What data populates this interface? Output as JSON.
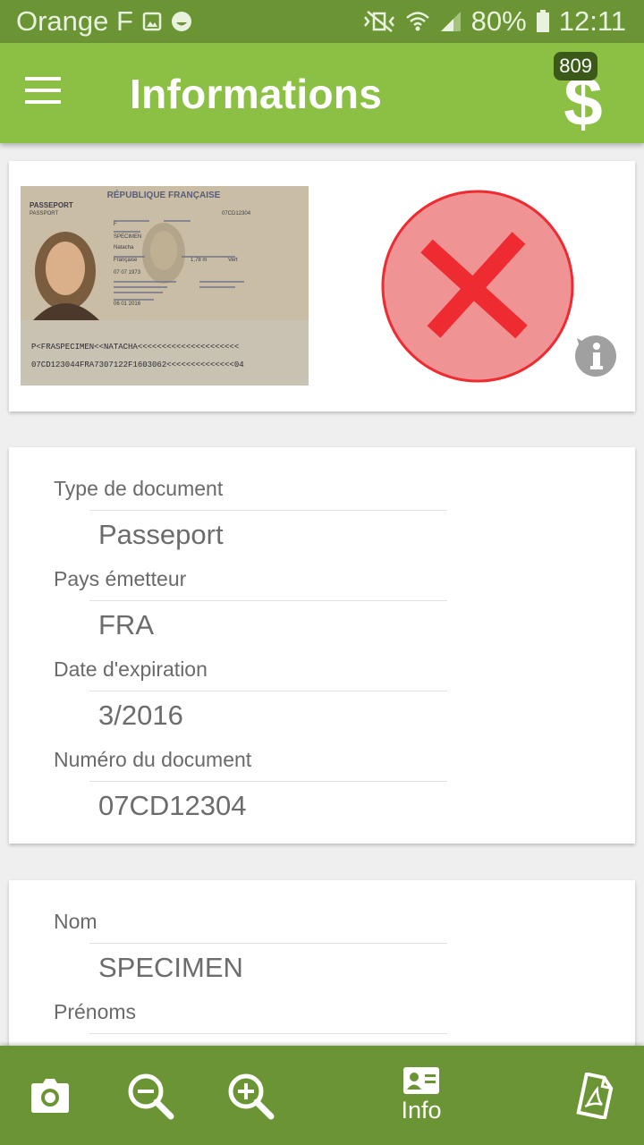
{
  "status_bar": {
    "carrier": "Orange F",
    "battery": "80%",
    "time": "12:11",
    "icons": [
      "image-icon",
      "smiley-icon",
      "vibrate-off-icon",
      "wifi-icon",
      "signal-icon",
      "battery-icon"
    ]
  },
  "app_bar": {
    "title": "Informations",
    "credits": "809",
    "menu_icon": "hamburger-menu-icon",
    "credits_icon": "dollar-icon"
  },
  "document": {
    "image": {
      "country_header": "RÉPUBLIQUE FRANÇAISE",
      "doc_label": "PASSEPORT",
      "doc_label_en": "PASSPORT",
      "doc_number": "07CD12304",
      "surname": "SPECIMEN",
      "given_name": "Natacha",
      "sex": "F",
      "nationality": "Française",
      "height": "1,78 m",
      "eyes": "Vert",
      "birth_date": "07 07 1973",
      "issue_date": "06 01 2016",
      "mrz_line1": "P<FRASPECIMEN<<NATACHA<<<<<<<<<<<<<<<<<<<<<",
      "mrz_line2": "07CD123044FRA7307122F1603062<<<<<<<<<<<<<<04"
    },
    "verification_status": "invalid",
    "status_color": "#f09394",
    "status_mark_color": "#ee2b30"
  },
  "document_info": {
    "fields": [
      {
        "label": "Type de document",
        "value": "Passeport"
      },
      {
        "label": "Pays émetteur",
        "value": "FRA"
      },
      {
        "label": "Date d'expiration",
        "value": "3/2016"
      },
      {
        "label": "Numéro du document",
        "value": "07CD12304"
      }
    ]
  },
  "holder_info": {
    "fields": [
      {
        "label": "Nom",
        "value": "SPECIMEN"
      },
      {
        "label": "Prénoms",
        "value": ""
      }
    ]
  },
  "bottom_bar": {
    "camera_icon": "camera-icon",
    "zoom_out_icon": "zoom-out-icon",
    "zoom_in_icon": "zoom-in-icon",
    "info_icon": "id-card-icon",
    "info_label": "Info",
    "pdf_icon": "pdf-icon"
  },
  "colors": {
    "app_bar": "#8bc045",
    "status_bar": "#6b9434",
    "bottom_bar": "#6b9434",
    "badge": "#3b5a19"
  }
}
